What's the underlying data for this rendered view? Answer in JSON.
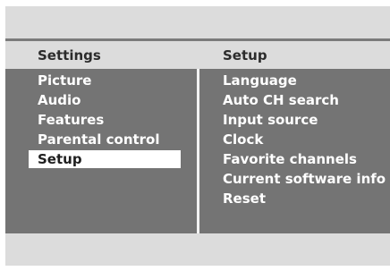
{
  "header": {
    "left_title": "Settings",
    "right_title": "Setup"
  },
  "settings_menu": {
    "items": [
      "Picture",
      "Audio",
      "Features",
      "Parental control",
      "Setup"
    ],
    "selected_index": 4
  },
  "setup_menu": {
    "items": [
      "Language",
      "Auto CH search",
      "Input source",
      "Clock",
      "Favorite channels",
      "Current software info",
      "Reset"
    ]
  },
  "colors": {
    "body_bg": "#747474",
    "bar_bg": "#dcdcdc",
    "highlight_bg": "#ffffff",
    "text_light": "#ffffff",
    "text_dark": "#2c2c2c"
  }
}
